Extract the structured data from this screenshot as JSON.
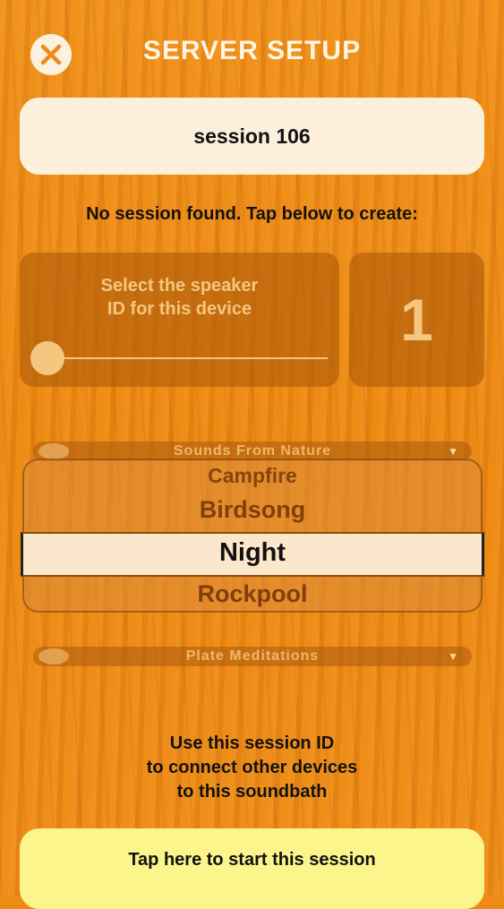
{
  "header": {
    "title": "SERVER SETUP",
    "close_icon": "close-icon"
  },
  "session": {
    "value": "session 106"
  },
  "notice": "No session found. Tap below to create:",
  "speaker": {
    "label_line1": "Select the speaker",
    "label_line2": "ID for this device",
    "id_value": "1",
    "slider_level": 0
  },
  "sound_picker": {
    "header": "Sounds From Nature",
    "items": [
      "Campfire",
      "Birdsong",
      "Night",
      "Rockpool"
    ],
    "selected": "Night"
  },
  "plate_picker": {
    "header": "Plate Meditations"
  },
  "instructions": {
    "line1": "Use this session ID",
    "line2": "to connect other devices",
    "line3": "to this soundbath"
  },
  "start_button": {
    "label": "Tap here to start this session"
  },
  "colors": {
    "background": "#ee8a16",
    "field": "#fcf0dc",
    "start_button": "#fbf58c",
    "panel_text": "#f4c680"
  }
}
